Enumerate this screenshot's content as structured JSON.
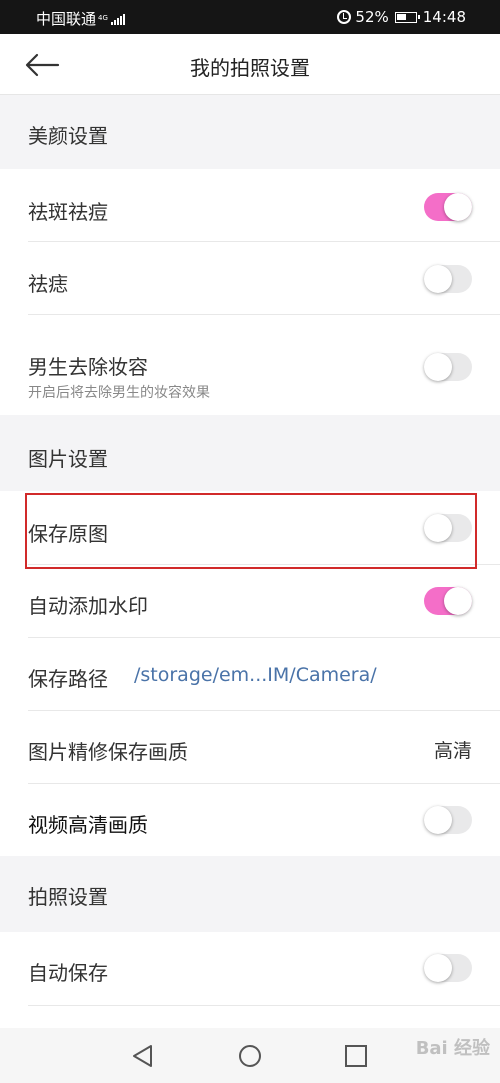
{
  "status_bar": {
    "carrier": "中国联通",
    "network": "4G",
    "battery": "52%",
    "time": "14:48"
  },
  "header": {
    "title": "我的拍照设置"
  },
  "sections": {
    "beauty": "美颜设置",
    "picture": "图片设置",
    "photo": "拍照设置"
  },
  "rows": {
    "spot": {
      "label": "祛斑祛痘",
      "on": true
    },
    "mole": {
      "label": "祛痣",
      "on": false
    },
    "male_makeup": {
      "label": "男生去除妆容",
      "desc": "开启后将去除男生的妆容效果",
      "on": false
    },
    "save_original": {
      "label": "保存原图",
      "on": false
    },
    "watermark": {
      "label": "自动添加水印",
      "on": true
    },
    "save_path": {
      "label": "保存路径",
      "value": "/storage/em...IM/Camera/"
    },
    "quality": {
      "label": "图片精修保存画质",
      "value": "高清"
    },
    "video_hd": {
      "label": "视频高清画质",
      "on": false
    },
    "auto_save": {
      "label": "自动保存",
      "on": false
    }
  },
  "watermark_text": "Bai 经验",
  "colors": {
    "accent_pink": "#f46ec8",
    "highlight_red": "#d12a2a",
    "path_blue": "#4a73a8"
  }
}
